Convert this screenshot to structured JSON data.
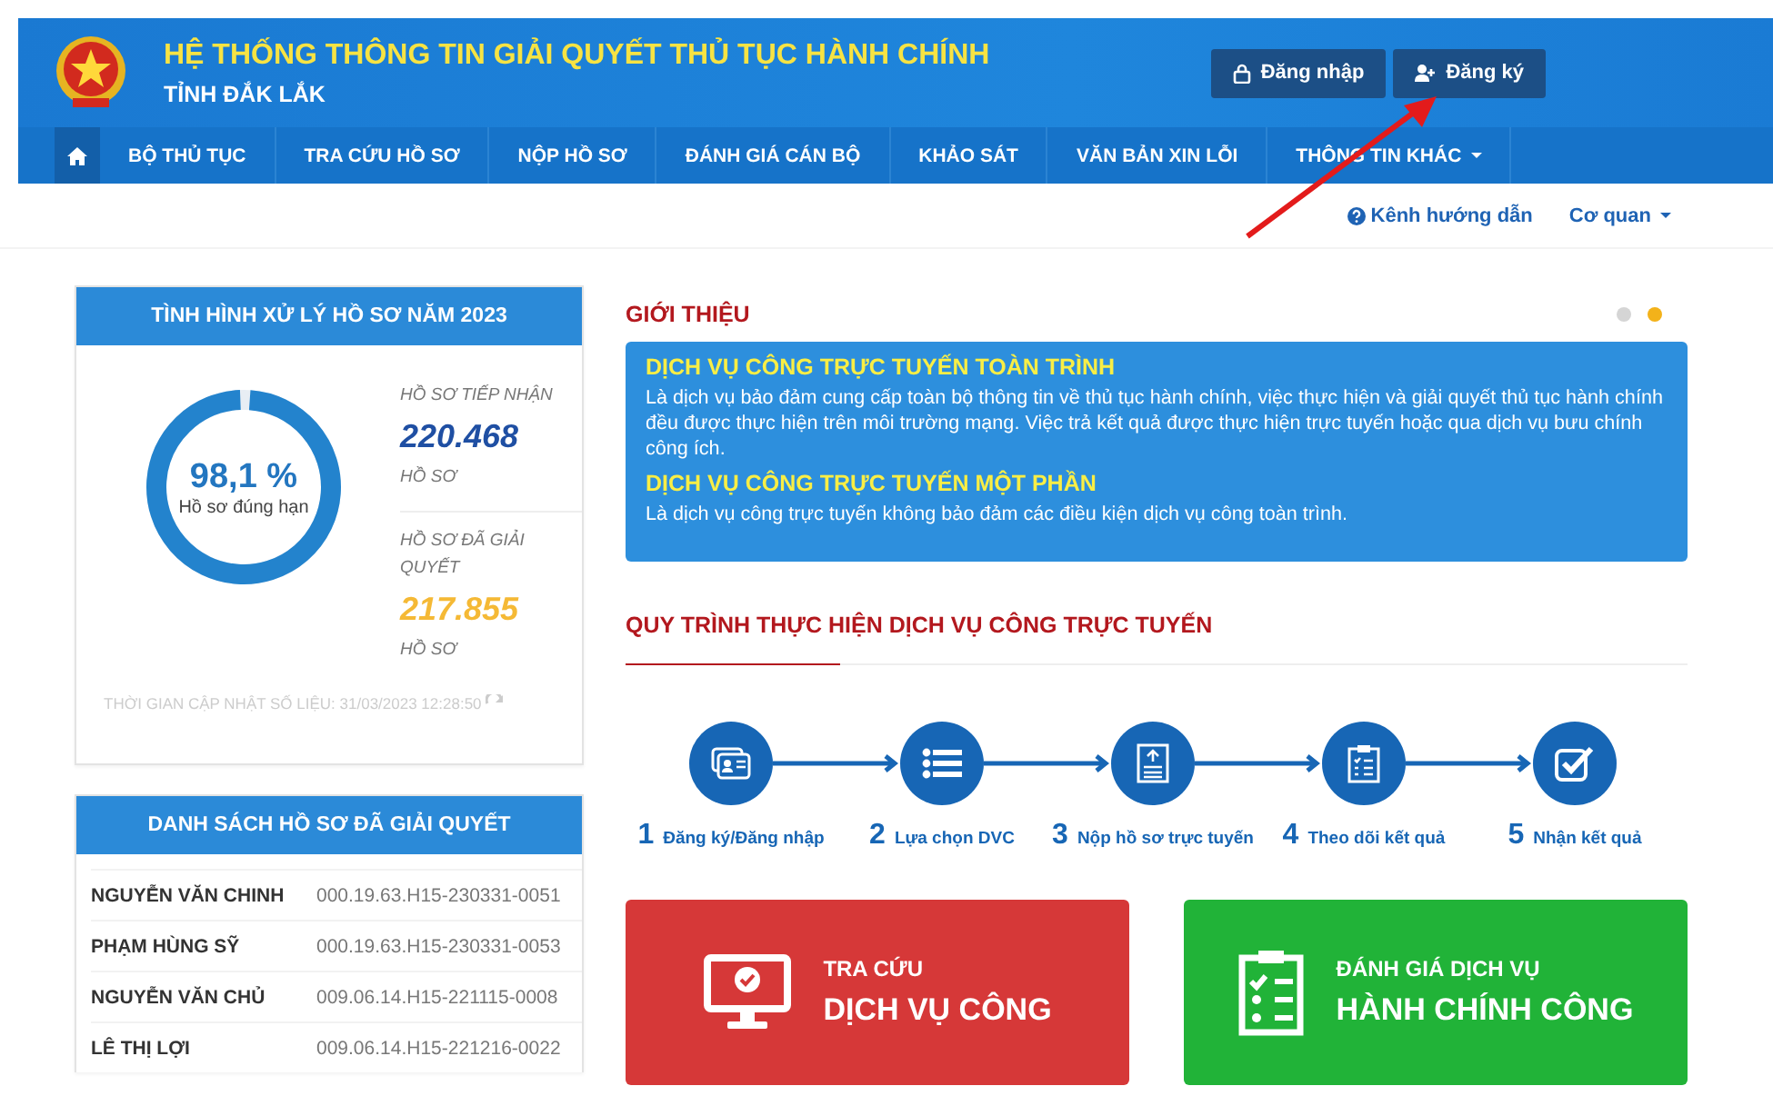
{
  "header": {
    "title": "HỆ THỐNG THÔNG TIN GIẢI QUYẾT THỦ TỤC HÀNH CHÍNH",
    "subtitle": "TỈNH ĐẮK LẮK",
    "buttons": [
      {
        "label": "Đăng nhập",
        "kind": "login"
      },
      {
        "label": "Đăng ký",
        "kind": "register"
      }
    ]
  },
  "nav": {
    "items": [
      {
        "label": "BỘ THỦ TỤC",
        "dropdown": false
      },
      {
        "label": "TRA CỨU HỒ SƠ",
        "dropdown": false
      },
      {
        "label": "NỘP HỒ SƠ",
        "dropdown": false
      },
      {
        "label": "ĐÁNH GIÁ CÁN BỘ",
        "dropdown": false
      },
      {
        "label": "KHẢO SÁT",
        "dropdown": false
      },
      {
        "label": "VĂN BẢN XIN LỖI",
        "dropdown": false
      },
      {
        "label": "THÔNG TIN KHÁC",
        "dropdown": true
      }
    ]
  },
  "subbar": {
    "help_link": "Kênh hướng dẫn",
    "agency_menu": "Cơ quan"
  },
  "stats_card": {
    "title": "TÌNH HÌNH XỬ LÝ HỒ SƠ NĂM 2023",
    "percent": "98,1 %",
    "percent_caption": "Hồ sơ đúng hạn",
    "level": 0.981,
    "stats": [
      {
        "label": "HỒ SƠ TIẾP NHẬN",
        "value": "220.468",
        "unit": "HỒ SƠ",
        "color": "#1f4fa3"
      },
      {
        "label": "HỒ SƠ ĐÃ GIẢI QUYẾT",
        "value": "217.855",
        "unit": "HỒ SƠ",
        "color": "#f5b935"
      }
    ],
    "updated": "THỜI GIAN CẬP NHẬT SỐ LIỆU: 31/03/2023 12:28:50"
  },
  "list_card": {
    "title": "DANH SÁCH HỒ SƠ ĐÃ GIẢI QUYẾT",
    "rows": [
      {
        "name": "NGUYỄN VĂN CHINH",
        "code": "000.19.63.H15-230331-0051"
      },
      {
        "name": "PHẠM HÙNG SỸ",
        "code": "000.19.63.H15-230331-0053"
      },
      {
        "name": "NGUYỄN VĂN CHỦ",
        "code": "009.06.14.H15-221115-0008"
      },
      {
        "name": "LÊ THỊ LỢI",
        "code": "009.06.14.H15-221216-0022"
      }
    ]
  },
  "intro": {
    "title": "GIỚI THIỆU",
    "dots": [
      {
        "selected": false
      },
      {
        "selected": true
      }
    ],
    "sections": [
      {
        "heading": "DỊCH VỤ CÔNG TRỰC TUYẾN TOÀN TRÌNH",
        "text": "Là dịch vụ bảo đảm cung cấp toàn bộ thông tin về thủ tục hành chính, việc thực hiện và giải quyết thủ tục hành chính đều được thực hiện trên môi trường mạng. Việc trả kết quả được thực hiện trực tuyến hoặc qua dịch vụ bưu chính công ích."
      },
      {
        "heading": "DỊCH VỤ CÔNG TRỰC TUYẾN MỘT PHẦN",
        "text": "Là dịch vụ công trực tuyến không bảo đảm các điều kiện dịch vụ công toàn trình."
      }
    ]
  },
  "process": {
    "title": "QUY TRÌNH THỰC HIỆN DỊCH VỤ CÔNG TRỰC TUYẾN",
    "steps": [
      {
        "number": "1",
        "label": "Đăng ký/Đăng nhập",
        "kind": "idcard"
      },
      {
        "number": "2",
        "label": "Lựa chọn DVC",
        "kind": "list"
      },
      {
        "number": "3",
        "label": "Nộp hồ sơ trực tuyến",
        "kind": "upload"
      },
      {
        "number": "4",
        "label": "Theo dõi kết quả",
        "kind": "clipboard"
      },
      {
        "number": "5",
        "label": "Nhận kết quả",
        "kind": "check"
      }
    ]
  },
  "tiles": [
    {
      "kind": "lookup",
      "line1": "TRA CỨU",
      "line2": "DỊCH VỤ CÔNG",
      "color": "#d63838"
    },
    {
      "kind": "rating",
      "line1": "ĐÁNH GIÁ DỊCH VỤ",
      "line2": "HÀNH CHÍNH CÔNG",
      "color": "#21b338"
    }
  ]
}
